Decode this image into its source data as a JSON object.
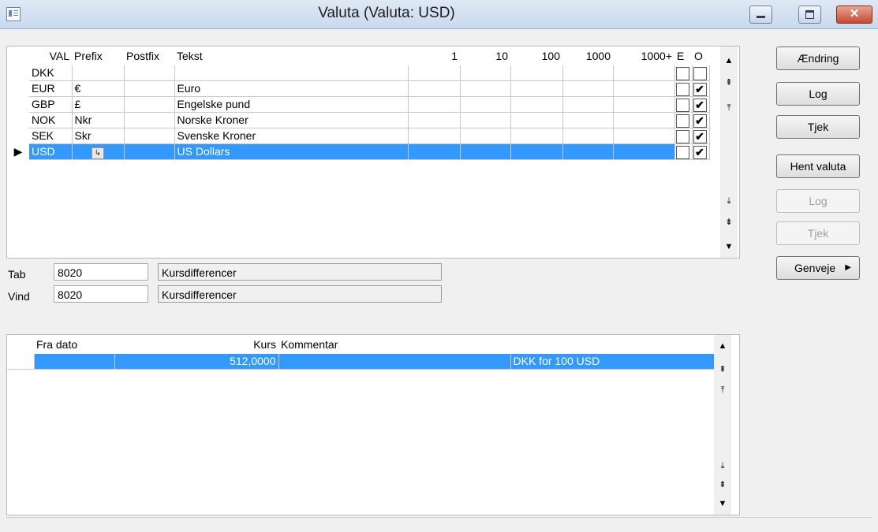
{
  "window": {
    "title": "Valuta (Valuta: USD)"
  },
  "currency_grid": {
    "headers": [
      "VAL",
      "Prefix",
      "Postfix",
      "Tekst",
      "1",
      "10",
      "100",
      "1000",
      "1000+",
      "E",
      "O"
    ],
    "rows": [
      {
        "val": "DKK",
        "prefix": "",
        "postfix": "",
        "tekst": "",
        "e": "",
        "o": ""
      },
      {
        "val": "EUR",
        "prefix": "€",
        "postfix": "",
        "tekst": "Euro",
        "e": "",
        "o": "✔"
      },
      {
        "val": "GBP",
        "prefix": "£",
        "postfix": "",
        "tekst": "Engelske pund",
        "e": "",
        "o": "✔"
      },
      {
        "val": "NOK",
        "prefix": "Nkr",
        "postfix": "",
        "tekst": "Norske Kroner",
        "e": "",
        "o": "✔"
      },
      {
        "val": "SEK",
        "prefix": "Skr",
        "postfix": "",
        "tekst": "Svenske Kroner",
        "e": "",
        "o": "✔"
      },
      {
        "val": "USD",
        "prefix": "",
        "postfix": "",
        "tekst": "US Dollars",
        "e": "",
        "o": "✔",
        "selected": true
      }
    ]
  },
  "accounts": {
    "tab_label": "Tab",
    "tab_value": "8020",
    "tab_desc": "Kursdifferencer",
    "vind_label": "Vind",
    "vind_value": "8020",
    "vind_desc": "Kursdifferencer"
  },
  "rate_grid": {
    "headers": [
      "Fra dato",
      "Kurs",
      "Kommentar",
      ""
    ],
    "rows": [
      {
        "fra_dato": "",
        "kurs": "512,0000",
        "kommentar": "",
        "note": "DKK for 100 USD",
        "selected": true
      }
    ]
  },
  "buttons": {
    "aendring": "Ændring",
    "log": "Log",
    "tjek": "Tjek",
    "hent_valuta": "Hent valuta",
    "log2": "Log",
    "tjek2": "Tjek",
    "genveje": "Genveje"
  },
  "icons": {
    "app": "grid-window-icon",
    "scroll_up": "arrow-up-icon",
    "scroll_down": "arrow-down-icon",
    "page_up": "page-up-icon",
    "page_down": "page-down-icon",
    "first": "first-icon",
    "last": "last-icon",
    "row_pointer": "row-pointer-icon",
    "submenu": "chevron-right-icon"
  },
  "colors": {
    "selection": "#3399ff",
    "close_button": "#c44a33",
    "title_bar": "#c9d9ee"
  }
}
